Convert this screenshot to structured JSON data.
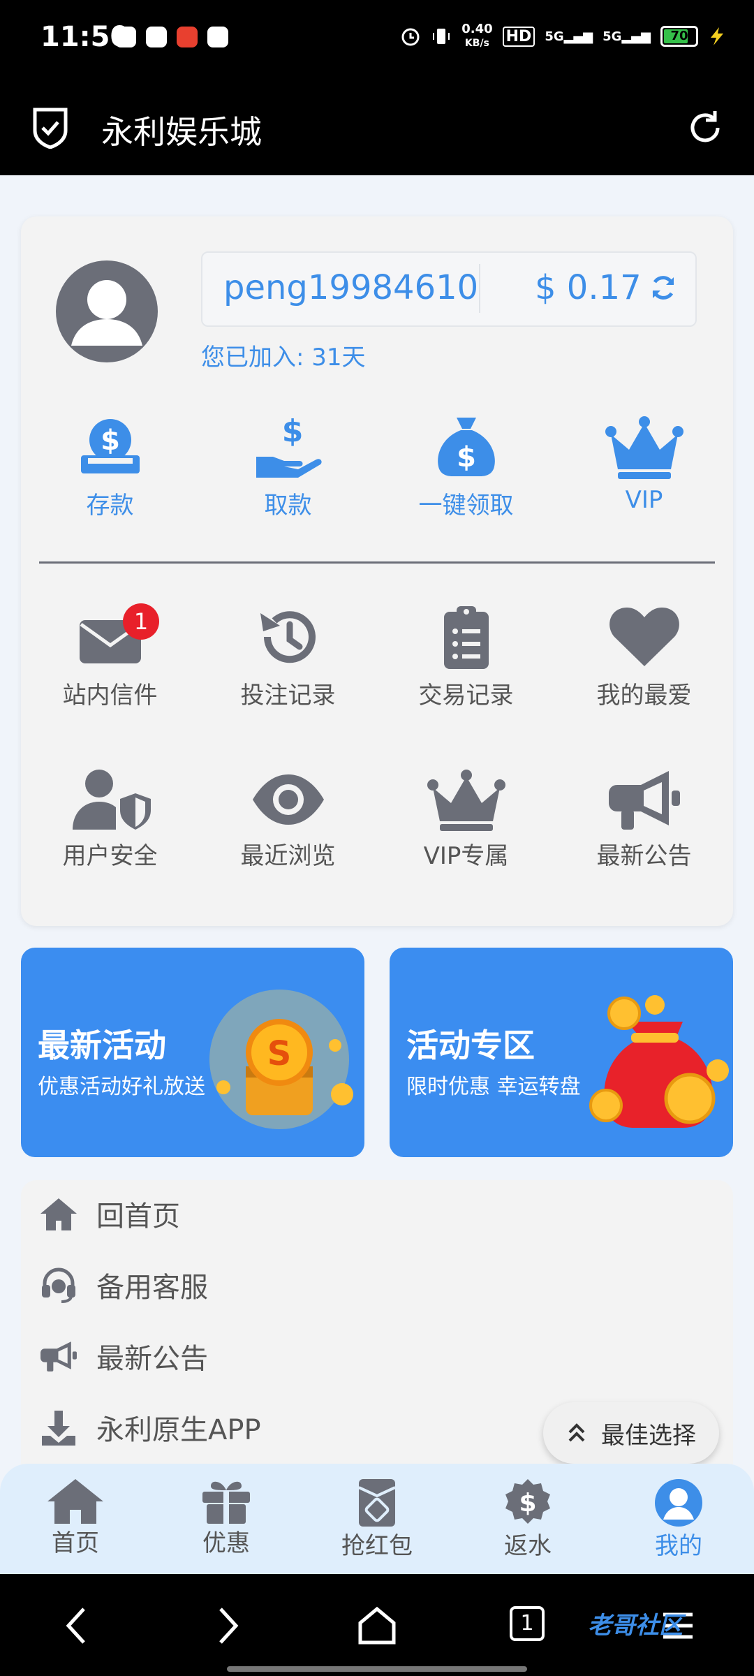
{
  "status_bar": {
    "time": "11:50",
    "net_speed_value": "0.40",
    "net_speed_unit": "KB/s",
    "hd": "HD",
    "sim1": "5G",
    "sim2": "5G",
    "battery": "70"
  },
  "header": {
    "title": "永利娱乐城"
  },
  "account": {
    "username": "peng19984610",
    "balance": "$ 0.17",
    "joined": "您已加入: 31天"
  },
  "quick_actions": [
    {
      "label": "存款",
      "icon": "deposit-icon"
    },
    {
      "label": "取款",
      "icon": "withdraw-icon"
    },
    {
      "label": "一键领取",
      "icon": "money-bag-icon"
    },
    {
      "label": "VIP",
      "icon": "crown-icon"
    }
  ],
  "features_row1": [
    {
      "label": "站内信件",
      "icon": "mail-icon",
      "badge": "1"
    },
    {
      "label": "投注记录",
      "icon": "history-icon"
    },
    {
      "label": "交易记录",
      "icon": "clipboard-list-icon"
    },
    {
      "label": "我的最爱",
      "icon": "heart-icon"
    }
  ],
  "features_row2": [
    {
      "label": "用户安全",
      "icon": "user-shield-icon"
    },
    {
      "label": "最近浏览",
      "icon": "eye-icon"
    },
    {
      "label": "VIP专属",
      "icon": "crown-icon"
    },
    {
      "label": "最新公告",
      "icon": "megaphone-icon"
    }
  ],
  "banners": [
    {
      "title": "最新活动",
      "subtitle": "优惠活动好礼放送"
    },
    {
      "title": "活动专区",
      "subtitle": "限时优惠 幸运转盘"
    }
  ],
  "menu": [
    {
      "label": "回首页",
      "icon": "home-icon"
    },
    {
      "label": "备用客服",
      "icon": "headset-icon"
    },
    {
      "label": "最新公告",
      "icon": "megaphone-icon"
    },
    {
      "label": "永利原生APP",
      "icon": "download-icon"
    }
  ],
  "best_choice": "最佳选择",
  "tabs": [
    {
      "label": "首页",
      "icon": "home-icon"
    },
    {
      "label": "优惠",
      "icon": "gift-icon"
    },
    {
      "label": "抢红包",
      "icon": "red-envelope-icon"
    },
    {
      "label": "返水",
      "icon": "dollar-badge-icon"
    },
    {
      "label": "我的",
      "icon": "user-circle-icon",
      "active": true
    }
  ],
  "nav_tab_count": "1",
  "watermark": "老哥社区",
  "colors": {
    "accent": "#3d8ee8",
    "icon_gray": "#6b6e78",
    "banner": "#3b8df0",
    "badge": "#e8202a"
  }
}
